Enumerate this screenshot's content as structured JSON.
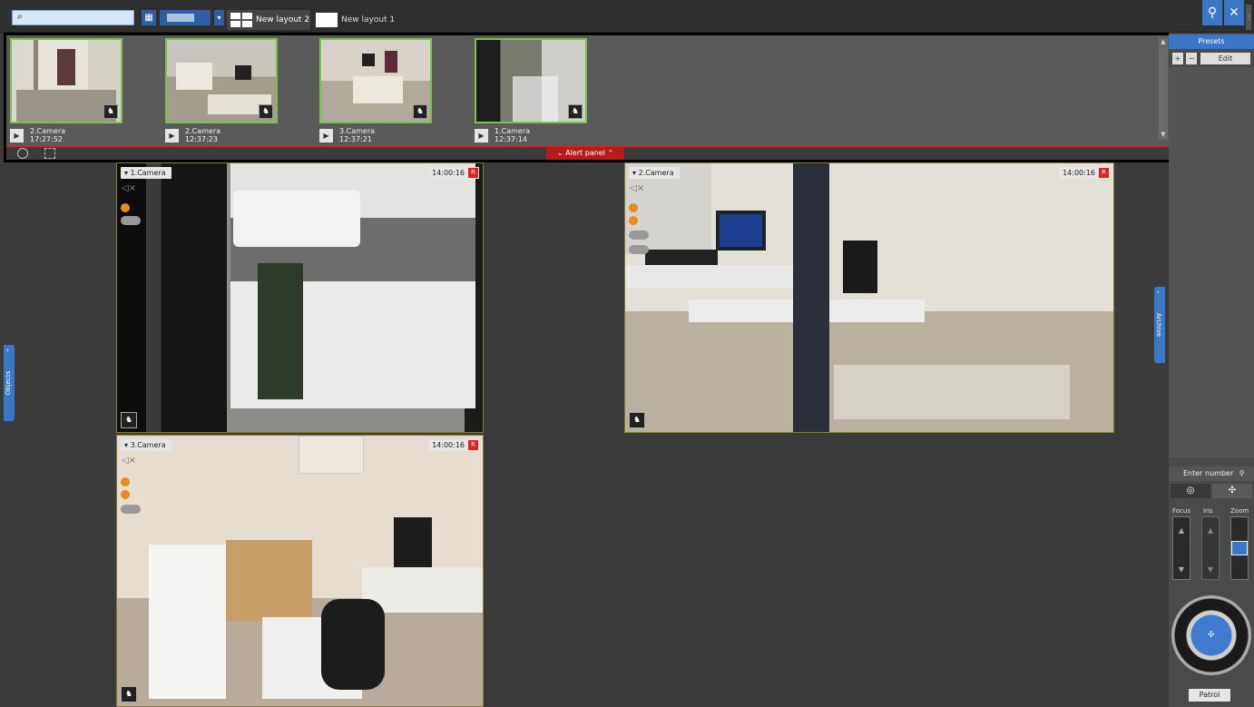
{
  "topbar": {
    "search_placeholder": "",
    "tabs": [
      {
        "label": "New layout 2",
        "active": true
      },
      {
        "label": "New layout 1",
        "active": false
      }
    ]
  },
  "alert_panel": {
    "toggle_label": "Alert panel",
    "items": [
      {
        "camera": "2.Camera",
        "time": "17:27:52"
      },
      {
        "camera": "2.Camera",
        "time": "12:37:23"
      },
      {
        "camera": "3.Camera",
        "time": "12:37:21"
      },
      {
        "camera": "1.Camera",
        "time": "12:37:14"
      }
    ]
  },
  "cameras": [
    {
      "name": "1.Camera",
      "time": "14:00:16"
    },
    {
      "name": "2.Camera",
      "time": "14:00:16"
    },
    {
      "name": "3.Camera",
      "time": "14:00:16"
    }
  ],
  "rec_badge": "R",
  "side_tabs": {
    "objects": "Objects",
    "archive": "Archive"
  },
  "right_panel": {
    "presets_title": "Presets",
    "add_label": "+",
    "remove_label": "−",
    "edit_label": "Edit",
    "enter_number": "Enter number",
    "focus_label": "Focus",
    "iris_label": "Iris",
    "zoom_label": "Zoom",
    "patrol_label": "Patrol"
  },
  "colors": {
    "accent": "#3a77c7",
    "alert_red": "#c8282a",
    "tile_border": "#8a7a3a",
    "alert_border": "#7dbe55"
  },
  "icons": [
    "search-icon",
    "grid-icon",
    "zoom-search-icon",
    "settings-icon",
    "clock-icon",
    "play-icon",
    "ptz-icon",
    "speaker-icon"
  ]
}
